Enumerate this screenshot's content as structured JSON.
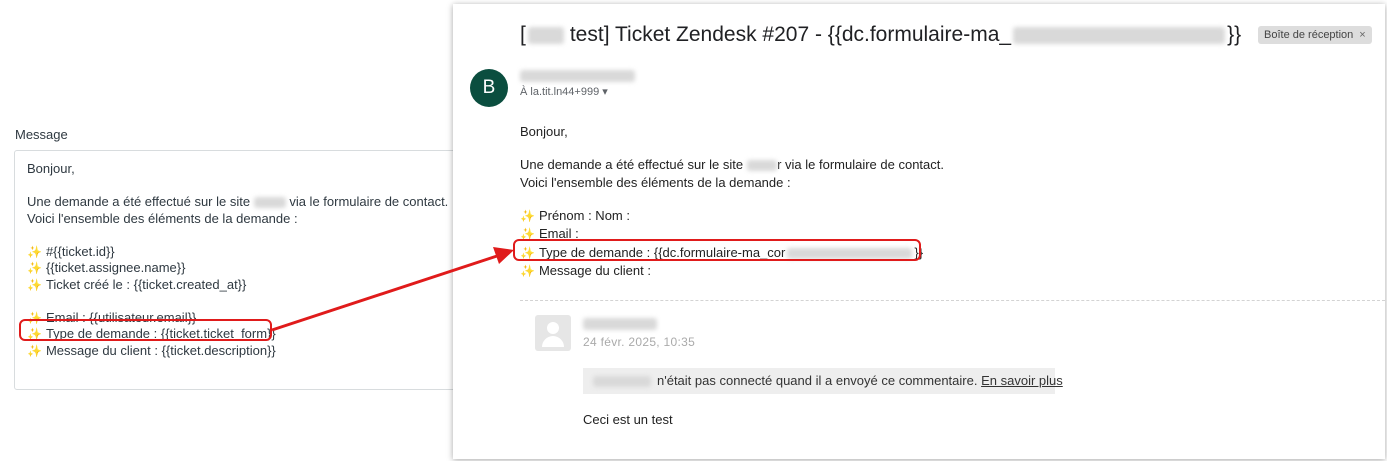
{
  "editor": {
    "label": "Message",
    "greeting": "Bonjour,",
    "line1_pre": "Une demande a été effectué sur le site",
    "line1_post": "via le formulaire de contact.",
    "line2": "Voici l'ensemble des éléments de la demande :",
    "spark": "✨",
    "ticket_id": "#{{ticket.id}}",
    "assignee": "{{ticket.assignee.name}}",
    "created": "Ticket créé le : {{ticket.created_at}}",
    "email": "Email : {{utilisateur.email}}",
    "type": "Type de demande : {{ticket.ticket_form}}",
    "message": "Message du client : {{ticket.description}}"
  },
  "email": {
    "subject_pre": "[",
    "subject_mid": "test] Ticket Zendesk #207 - {{dc.formulaire-ma_",
    "subject_post": "}}",
    "badge": "Boîte de réception",
    "badge_close": "×",
    "avatar_letter": "B",
    "to": "À la.tit.ln44+999",
    "to_caret": "▾",
    "greeting": "Bonjour,",
    "line1_pre": "Une demande a été effectué sur le site",
    "line1_post": "r via le formulaire de contact.",
    "line2": "Voici l'ensemble des éléments de la demande :",
    "spark": "✨",
    "name": "Prénom : Nom :",
    "email_label": "Email :",
    "type_pre": "Type de demande : {{dc.formulaire-ma_cor",
    "type_post": "}}",
    "message": "Message du client :",
    "comment_date": "24 févr. 2025, 10:35",
    "notice_text": "n'était pas connecté quand il a envoyé ce commentaire.",
    "notice_link": "En savoir plus",
    "comment_text": "Ceci est un test"
  },
  "colors": {
    "highlight": "#e01b1b",
    "avatar": "#0b4e3f"
  }
}
